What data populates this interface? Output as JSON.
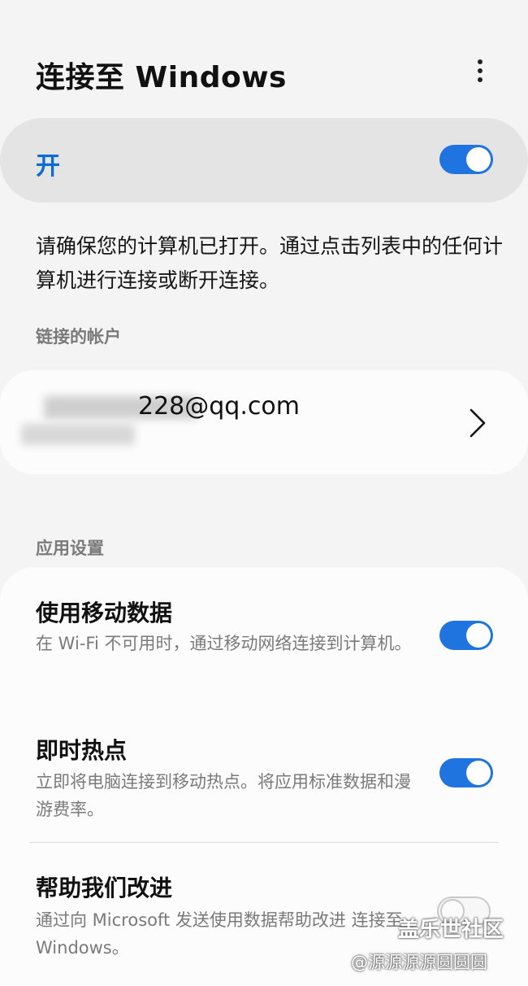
{
  "header": {
    "title": "连接至 Windows",
    "more_icon": "more-vertical-icon"
  },
  "master_switch": {
    "label": "开",
    "state": "on"
  },
  "description": "请确保您的计算机已打开。通过点击列表中的任何计算机进行连接或断开连接。",
  "linked_accounts": {
    "header": "链接的帐户",
    "email": "228@qq.com",
    "chevron_icon": "chevron-right-icon"
  },
  "app_settings": {
    "header": "应用设置",
    "items": [
      {
        "title": "使用移动数据",
        "description": "在 Wi-Fi 不可用时，通过移动网络连接到计算机。",
        "state": "on"
      },
      {
        "title": "即时热点",
        "description": "立即将电脑连接到移动热点。将应用标准数据和漫游费率。",
        "state": "on"
      },
      {
        "title": "帮助我们改进",
        "description": "通过向 Microsoft 发送使用数据帮助改进 连接至 Windows。",
        "state": "off"
      }
    ]
  },
  "watermark": {
    "line1": "盖乐世社区",
    "line2": "@源源源源圆圆圆"
  },
  "colors": {
    "accent": "#1f74e0",
    "master_label": "#0b6cd6",
    "background": "#f4f4f4"
  }
}
